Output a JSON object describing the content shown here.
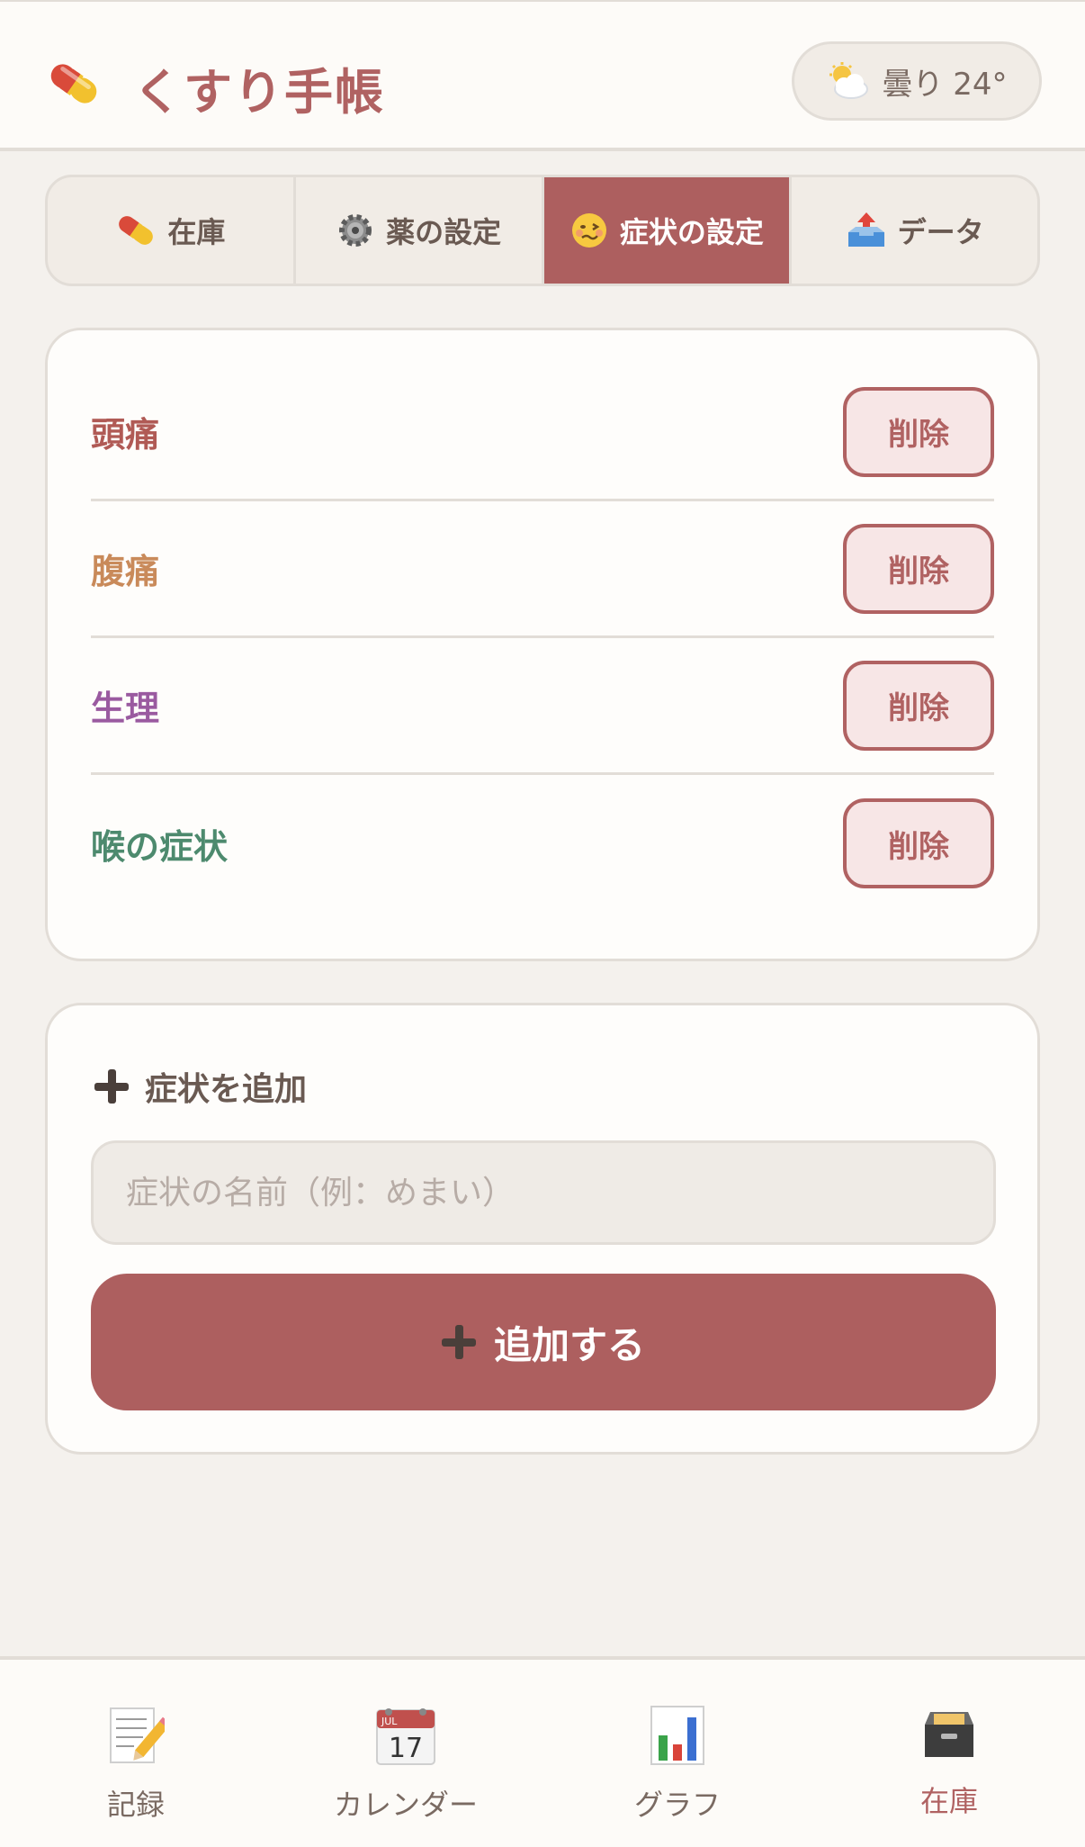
{
  "header": {
    "title": "くすり手帳",
    "logo_icon": "pill-icon",
    "weather": {
      "icon": "sun-behind-cloud-icon",
      "text": "曇り 24°"
    }
  },
  "tabs": [
    {
      "label": "在庫",
      "icon": "pill-icon",
      "active": false
    },
    {
      "label": "薬の設定",
      "icon": "gear-icon",
      "active": false
    },
    {
      "label": "症状の設定",
      "icon": "woozy-face-icon",
      "active": true
    },
    {
      "label": "データ",
      "icon": "outbox-tray-icon",
      "active": false
    }
  ],
  "symptoms": [
    {
      "name": "頭痛",
      "color": "#b05a55",
      "delete_label": "削除"
    },
    {
      "name": "腹痛",
      "color": "#c98a5a",
      "delete_label": "削除"
    },
    {
      "name": "生理",
      "color": "#9a5aa0",
      "delete_label": "削除"
    },
    {
      "name": "喉の症状",
      "color": "#4d8a6e",
      "delete_label": "削除"
    }
  ],
  "add_section": {
    "title": "症状を追加",
    "input_value": "",
    "input_placeholder": "症状の名前（例：めまい）",
    "button_label": "追加する"
  },
  "bottom_nav": [
    {
      "label": "記録",
      "icon": "memo-icon",
      "active": false
    },
    {
      "label": "カレンダー",
      "icon": "calendar-icon",
      "active": false
    },
    {
      "label": "グラフ",
      "icon": "bar-chart-icon",
      "active": false
    },
    {
      "label": "在庫",
      "icon": "card-file-box-icon",
      "active": true
    }
  ],
  "colors": {
    "accent": "#ad5f5f",
    "background": "#f4f1ed",
    "card": "#fefdfb",
    "border": "#e2ddd7"
  }
}
